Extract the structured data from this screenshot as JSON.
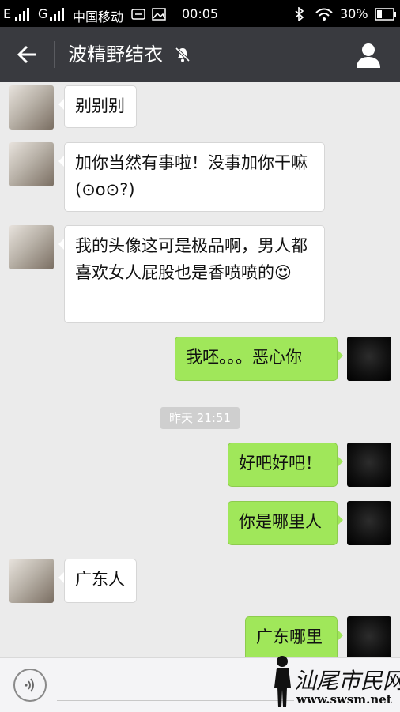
{
  "status_bar": {
    "signal_1": "E",
    "signal_2": "G",
    "carrier": "中国移动",
    "time": "00:05",
    "battery": "30%",
    "icons": [
      "bluetooth-icon",
      "wifi-icon",
      "battery-icon",
      "image-icon",
      "sim-icon"
    ]
  },
  "header": {
    "title": "波精野结衣",
    "icons": [
      "back-arrow-icon",
      "mute-icon",
      "profile-icon"
    ]
  },
  "messages": [
    {
      "side": "in",
      "text": "别别别"
    },
    {
      "side": "in",
      "text": "加你当然有事啦！没事加你干嘛(⊙o⊙?)"
    },
    {
      "side": "in",
      "text": "我的头像这可是极品啊，男人都喜欢女人屁股也是香喷喷的😍"
    },
    {
      "side": "out",
      "text": "我呸。。。恶心你"
    },
    {
      "side": "out",
      "text": "好吧好吧！"
    },
    {
      "side": "out",
      "text": "你是哪里人"
    },
    {
      "side": "in",
      "text": "广东人"
    },
    {
      "side": "out",
      "text": "广东哪里"
    }
  ],
  "timestamp": "昨天 21:51",
  "input_bar": {
    "icons": [
      "voice-icon"
    ]
  },
  "watermark": {
    "text": "汕尾市民网",
    "url": "www.swsm.net"
  },
  "colors": {
    "header_bg": "#393a3f",
    "chat_bg": "#ebebeb",
    "outgoing_bubble": "#a0e75a",
    "incoming_bubble": "#ffffff"
  }
}
